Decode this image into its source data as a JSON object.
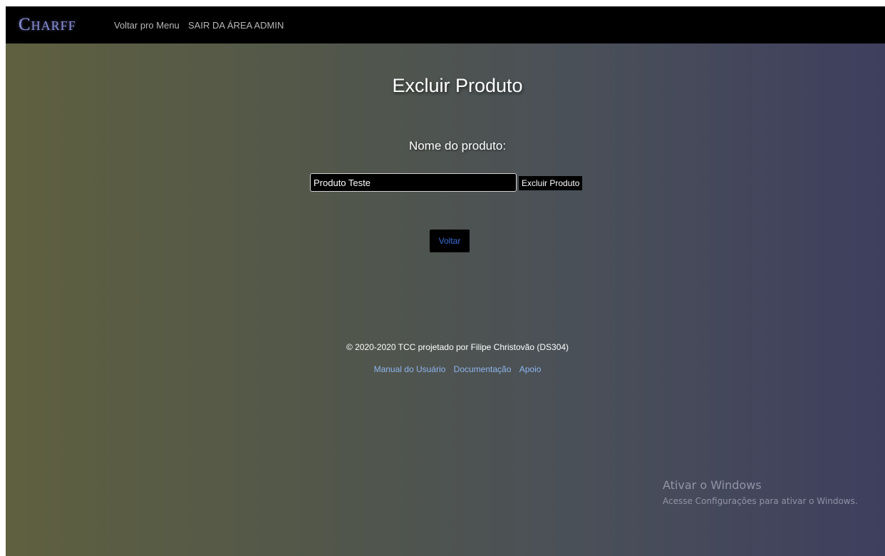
{
  "navbar": {
    "brand": "Charff",
    "links": [
      {
        "label": "Voltar pro Menu"
      },
      {
        "label": "SAIR DA ÁREA ADMIN"
      }
    ]
  },
  "form": {
    "title": "Excluir Produto",
    "field_label": "Nome do produto:",
    "input_value": "Produto Teste",
    "submit_label": "Excluir Produto",
    "back_label": "Voltar"
  },
  "footer": {
    "copyright": "© 2020-2020 TCC projetado por Filipe Christovão (DS304)",
    "links": [
      {
        "label": "Manual do Usuário"
      },
      {
        "label": "Documentação"
      },
      {
        "label": "Apoio"
      }
    ]
  },
  "watermark": {
    "title": "Ativar o Windows",
    "subtitle": "Acesse Configurações para ativar o Windows."
  },
  "colors": {
    "navbar_bg": "#000000",
    "brand": "#8a8fd9",
    "link": "#8fb4ee",
    "back_button_text": "#3a6fd8"
  }
}
